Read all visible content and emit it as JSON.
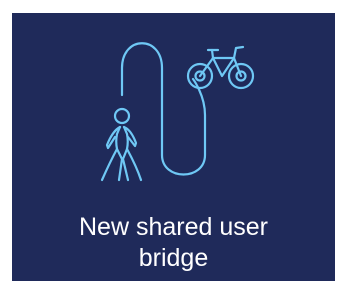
{
  "tile": {
    "background_color": "#1f2a5a",
    "icon_color": "#6fc8f5",
    "text_color": "#ffffff",
    "caption_lines": [
      "New shared user",
      "bridge"
    ]
  },
  "icons": [
    "pedestrian-icon",
    "path-curve-icon",
    "bicycle-icon"
  ]
}
